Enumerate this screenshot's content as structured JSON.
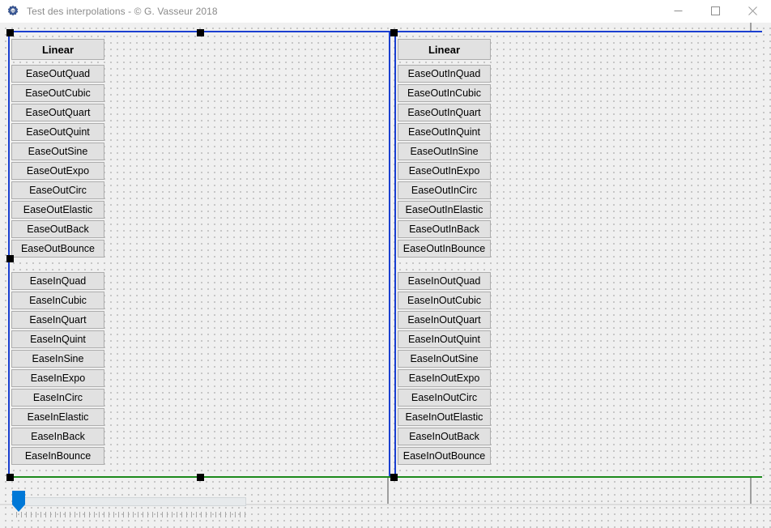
{
  "window": {
    "title": "Test des interpolations - © G. Vasseur 2018",
    "icon": "app-gear-icon",
    "controls": {
      "minimize": "minimize-icon",
      "maximize": "maximize-icon",
      "close": "close-icon"
    }
  },
  "colors": {
    "accent": "#0078d7",
    "selection_outline_blue": "#1a3fd0",
    "selection_outline_green": "#1c8a1c",
    "selection_handle": "#000000",
    "button_face": "#e1e1e1",
    "button_border": "#adadad",
    "canvas": "#f0f0f0",
    "title_text": "#8a8a8a"
  },
  "panels": [
    {
      "name": "ease-out-panel",
      "header": {
        "label": "Linear",
        "bold": true
      },
      "buttons": [
        "EaseOutQuad",
        "EaseOutCubic",
        "EaseOutQuart",
        "EaseOutQuint",
        "EaseOutSine",
        "EaseOutExpo",
        "EaseOutCirc",
        "EaseOutElastic",
        "EaseOutBack",
        "EaseOutBounce"
      ]
    },
    {
      "name": "ease-out-in-panel",
      "header": {
        "label": "Linear",
        "bold": true
      },
      "buttons": [
        "EaseOutInQuad",
        "EaseOutInCubic",
        "EaseOutInQuart",
        "EaseOutInQuint",
        "EaseOutInSine",
        "EaseOutInExpo",
        "EaseOutInCirc",
        "EaseOutInElastic",
        "EaseOutInBack",
        "EaseOutInBounce"
      ]
    },
    {
      "name": "ease-in-panel",
      "buttons": [
        "EaseInQuad",
        "EaseInCubic",
        "EaseInQuart",
        "EaseInQuint",
        "EaseInSine",
        "EaseInExpo",
        "EaseInCirc",
        "EaseInElastic",
        "EaseInBack",
        "EaseInBounce"
      ]
    },
    {
      "name": "ease-in-out-panel",
      "buttons": [
        "EaseInOutQuad",
        "EaseInOutCubic",
        "EaseInOutQuart",
        "EaseInOutQuint",
        "EaseInOutSine",
        "EaseInOutExpo",
        "EaseInOutCirc",
        "EaseInOutElastic",
        "EaseInOutBack",
        "EaseInOutBounce"
      ]
    }
  ],
  "trackbar": {
    "name": "duration-trackbar",
    "value": 0,
    "min": 0,
    "max": 100,
    "tick_count": 48
  }
}
